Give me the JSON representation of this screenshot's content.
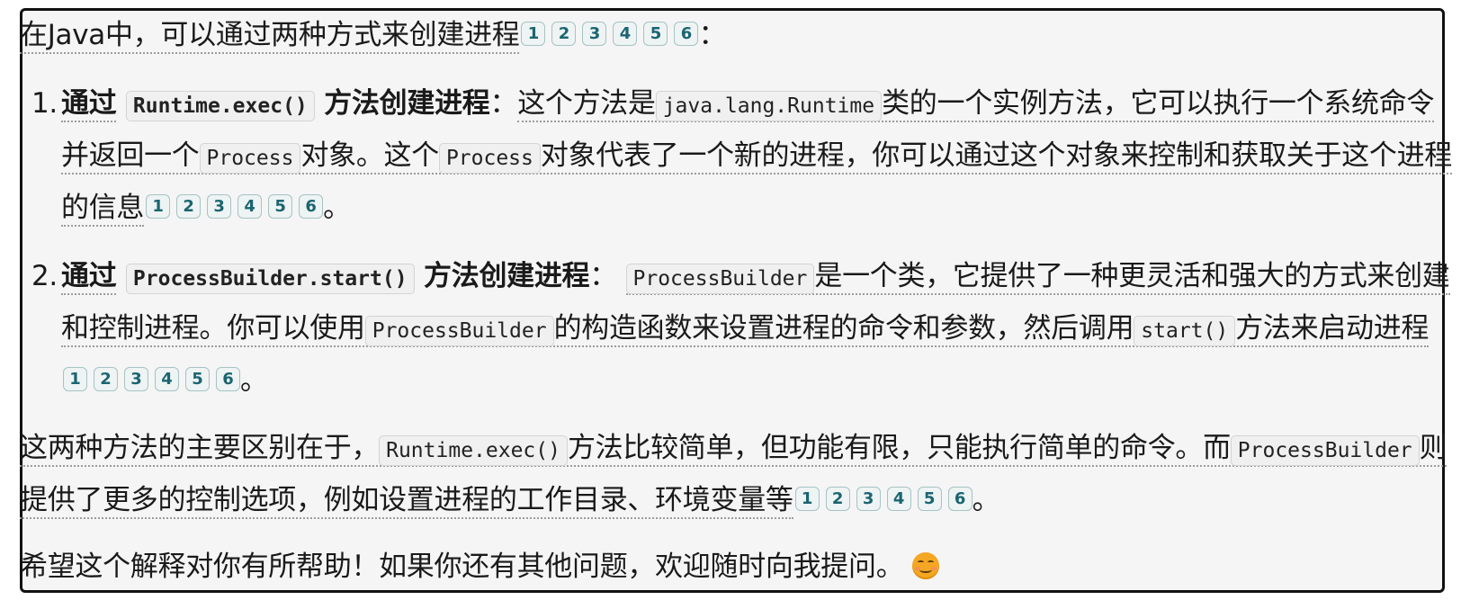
{
  "intro": {
    "text": "在Java中，可以通过两种方式来创建进程",
    "suffix": "："
  },
  "citations": [
    "1",
    "2",
    "3",
    "4",
    "5",
    "6"
  ],
  "list": [
    {
      "number": "1.",
      "bold_prefix": "通过",
      "bold_code": "Runtime.exec()",
      "bold_suffix": "方法创建进程",
      "colon": "：",
      "t1": "这个方法是",
      "c1": "java.lang.Runtime",
      "t2": "类的一个实例方法，它可以执行一个系统命令并返回一个",
      "c2": "Process",
      "t3": "对象。这个",
      "c3": "Process",
      "t4": "对象代表了一个新的进程，你可以通过这个对象来控制和获取关于这个进程的信息",
      "end": "。"
    },
    {
      "number": "2.",
      "bold_prefix": "通过",
      "bold_code": "ProcessBuilder.start()",
      "bold_suffix": "方法创建进程",
      "colon": "：",
      "c1": "ProcessBuilder",
      "t1": "是一个类，它提供了一种更灵活和强大的方式来创建和控制进程。你可以使用",
      "c2": "ProcessBuilder",
      "t2": "的构造函数来设置进程的命令和参数，然后调用",
      "c3": "start()",
      "t3": "方法来启动进程",
      "end": "。"
    }
  ],
  "difference": {
    "t1": "这两种方法的主要区别在于，",
    "c1": "Runtime.exec()",
    "t2": "方法比较简单，但功能有限，只能执行简单的命令。而",
    "c2": "ProcessBuilder",
    "t3": "则提供了更多的控制选项，例如设置进程的工作目录、环境变量等",
    "end": "。"
  },
  "closing": {
    "text": "希望这个解释对你有所帮助！如果你还有其他问题，欢迎随时向我提问。",
    "emoji": "smiling-face-icon"
  }
}
